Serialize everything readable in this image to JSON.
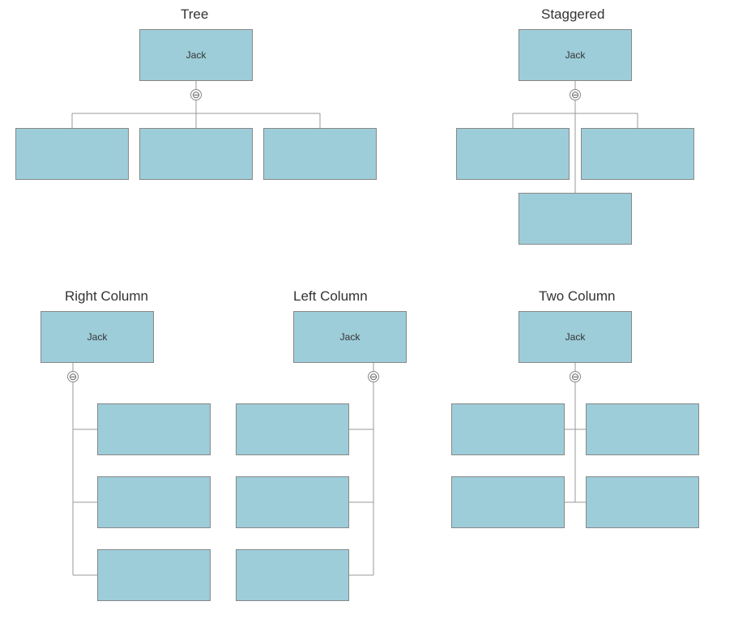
{
  "layouts": {
    "tree": {
      "title": "Tree",
      "root_label": "Jack",
      "children": [
        "",
        "",
        ""
      ]
    },
    "staggered": {
      "title": "Staggered",
      "root_label": "Jack",
      "children": [
        "",
        "",
        ""
      ]
    },
    "right_column": {
      "title": "Right Column",
      "root_label": "Jack",
      "children": [
        "",
        "",
        ""
      ]
    },
    "left_column": {
      "title": "Left Column",
      "root_label": "Jack",
      "children": [
        "",
        "",
        ""
      ]
    },
    "two_column": {
      "title": "Two Column",
      "root_label": "Jack",
      "children": [
        "",
        "",
        "",
        ""
      ]
    }
  },
  "collapse_glyph": "⊖",
  "colors": {
    "node_fill": "#9dcdd9",
    "node_border": "#888888",
    "line": "#999999"
  }
}
